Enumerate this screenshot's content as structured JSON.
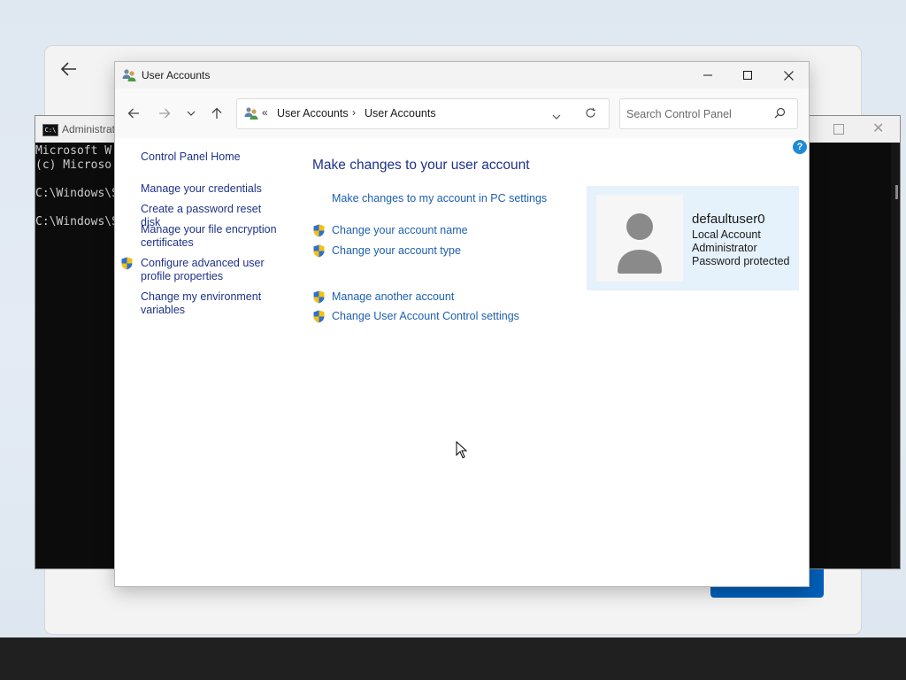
{
  "cmd": {
    "title": "Administrat",
    "icon_text": "C:\\",
    "lines": [
      "Microsoft W",
      "(c) Microso",
      "",
      "C:\\Windows\\S",
      "",
      "C:\\Windows\\S"
    ]
  },
  "window": {
    "title": "User Accounts",
    "controls": {
      "minimize": "minimize",
      "maximize": "maximize",
      "close": "close"
    }
  },
  "nav": {
    "address": {
      "overflow": "«",
      "crumbs": [
        "User Accounts",
        "User Accounts"
      ]
    },
    "search_placeholder": "Search Control Panel",
    "help_label": "?"
  },
  "left_pane": {
    "home": "Control Panel Home",
    "links": [
      "Manage your credentials",
      "Create a password reset disk",
      "Manage your file encryption certificates",
      "Configure advanced user profile properties",
      "Change my environment variables"
    ]
  },
  "main": {
    "heading": "Make changes to your user account",
    "pc_settings_link": "Make changes to my account in PC settings",
    "tasks_group1": [
      "Change your account name",
      "Change your account type"
    ],
    "tasks_group2": [
      "Manage another account",
      "Change User Account Control settings"
    ]
  },
  "user_card": {
    "name": "defaultuser0",
    "account_type": "Local Account",
    "role": "Administrator",
    "password_status": "Password protected"
  },
  "colors": {
    "link": "#1d5fb0",
    "heading": "#1e3287",
    "card_bg": "#e5f1fb",
    "accent": "#005fb8"
  }
}
